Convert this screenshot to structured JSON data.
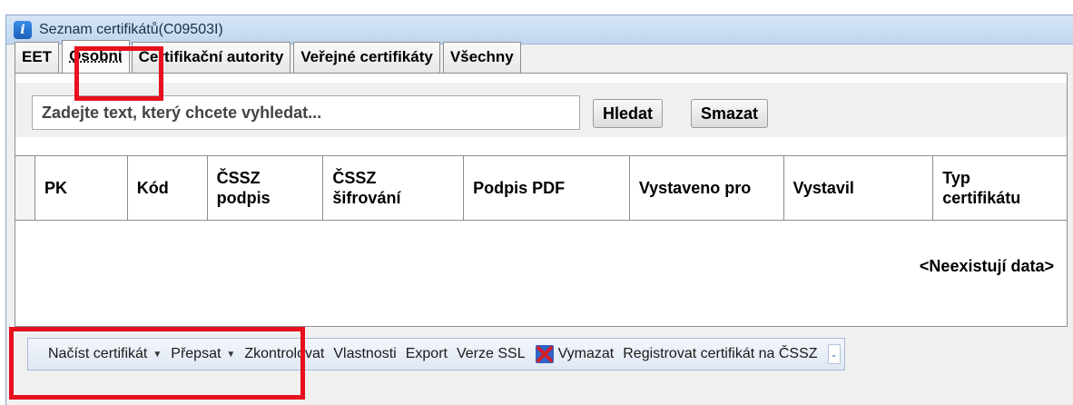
{
  "window": {
    "title": "Seznam certifikátů(C09503I)"
  },
  "tabs": [
    {
      "label": "EET"
    },
    {
      "label": "Osobní"
    },
    {
      "label": "Certifikační autority"
    },
    {
      "label": "Veřejné certifikáty"
    },
    {
      "label": "Všechny"
    }
  ],
  "search": {
    "placeholder": "Zadejte text, který chcete vyhledat...",
    "search_label": "Hledat",
    "clear_label": "Smazat"
  },
  "grid": {
    "columns": [
      "PK",
      "Kód",
      "ČSSZ podpis",
      "ČSSZ šifrování",
      "Podpis PDF",
      "Vystaveno pro",
      "Vystavil",
      "Typ certifikátu"
    ],
    "empty_text": "<Neexistují data>"
  },
  "toolbar": {
    "load_label": "Načíst certifikát",
    "overwrite_label": "Přepsat",
    "check_label": "Zkontrolovat",
    "properties_label": "Vlastnosti",
    "export_label": "Export",
    "ssl_label": "Verze SSL",
    "delete_label": "Vymazat",
    "register_label": "Registrovat certifikát na ČSSZ"
  },
  "colors": {
    "highlight": "#e8101d",
    "title_bar": "#c7dbf1",
    "delete_icon": "#d21f2b"
  },
  "icons": [
    "info-icon",
    "chevron-down-icon",
    "delete-x-icon"
  ]
}
